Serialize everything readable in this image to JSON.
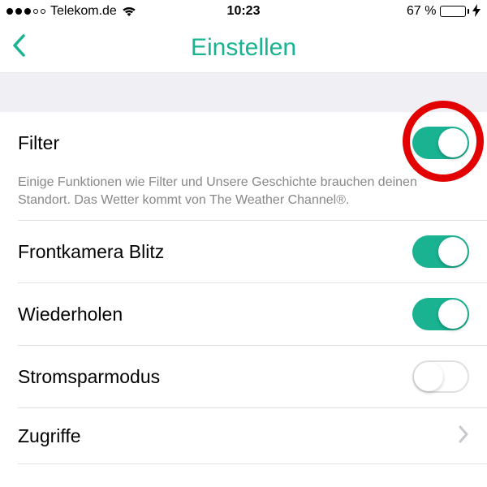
{
  "status": {
    "carrier": "Telekom.de",
    "time": "10:23",
    "battery_pct": "67 %"
  },
  "nav": {
    "title": "Einstellen"
  },
  "rows": {
    "filter": {
      "label": "Filter",
      "desc": "Einige Funktionen wie Filter und Unsere Geschichte brauchen deinen Standort. Das Wetter kommt von The Weather Channel®.",
      "on": true
    },
    "front_flash": {
      "label": "Frontkamera Blitz",
      "on": true
    },
    "repeat": {
      "label": "Wiederholen",
      "on": true
    },
    "power_save": {
      "label": "Stromsparmodus",
      "on": false
    },
    "access": {
      "label": "Zugriffe"
    }
  },
  "colors": {
    "accent": "#19b392",
    "highlight_ring": "#e30000",
    "battery_fill": "#1bd741"
  }
}
